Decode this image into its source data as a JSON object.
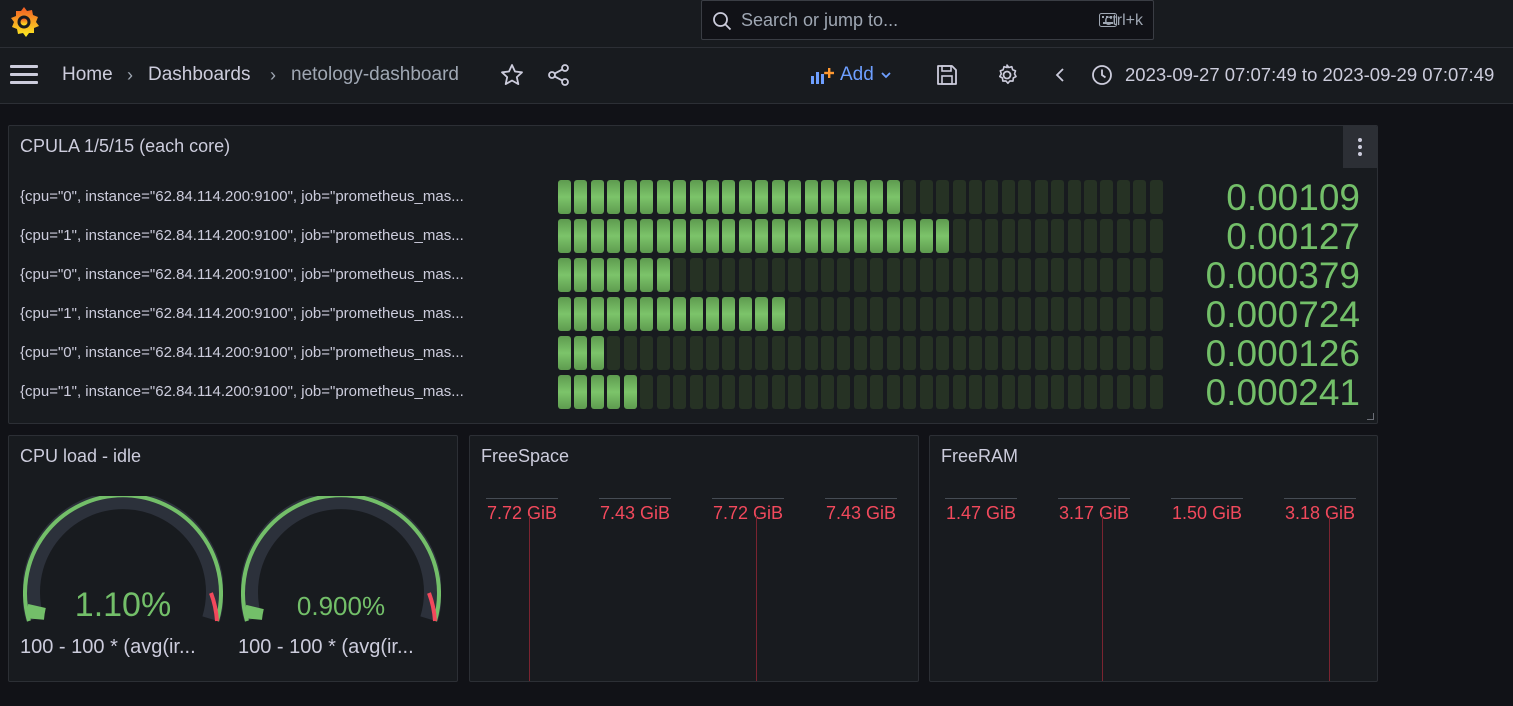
{
  "topbar": {
    "search_placeholder": "Search or jump to...",
    "search_shortcut": "ctrl+k"
  },
  "breadcrumb": {
    "home": "Home",
    "dashboards": "Dashboards",
    "current": "netology-dashboard"
  },
  "toolbar": {
    "add_label": "Add",
    "time_range": "2023-09-27 07:07:49 to 2023-09-29 07:07:49"
  },
  "panels": {
    "cpula": {
      "title": "CPULA 1/5/15 (each core)",
      "rows": [
        {
          "label": "{cpu=\"0\", instance=\"62.84.114.200:9100\", job=\"prometheus_mas...",
          "value": "0.00109",
          "lit": 21,
          "level": 0.57
        },
        {
          "label": "{cpu=\"1\", instance=\"62.84.114.200:9100\", job=\"prometheus_mas...",
          "value": "0.00127",
          "lit": 24,
          "level": 0.65
        },
        {
          "label": "{cpu=\"0\", instance=\"62.84.114.200:9100\", job=\"prometheus_mas...",
          "value": "0.000379",
          "lit": 7,
          "level": 0.19
        },
        {
          "label": "{cpu=\"1\", instance=\"62.84.114.200:9100\", job=\"prometheus_mas...",
          "value": "0.000724",
          "lit": 14,
          "level": 0.38
        },
        {
          "label": "{cpu=\"0\", instance=\"62.84.114.200:9100\", job=\"prometheus_mas...",
          "value": "0.000126",
          "lit": 3,
          "level": 0.08
        },
        {
          "label": "{cpu=\"1\", instance=\"62.84.114.200:9100\", job=\"prometheus_mas...",
          "value": "0.000241",
          "lit": 5,
          "level": 0.13
        }
      ],
      "total_cells": 37
    },
    "cpu_idle": {
      "title": "CPU load - idle",
      "gauges": [
        {
          "value": "1.10%",
          "fraction": 0.011,
          "label": "100 - 100 * (avg(ir..."
        },
        {
          "value": "0.900%",
          "fraction": 0.009,
          "label": "100 - 100 * (avg(ir..."
        }
      ]
    },
    "freespace": {
      "title": "FreeSpace",
      "values": [
        "7.72 GiB",
        "7.43 GiB",
        "7.72 GiB",
        "7.43 GiB"
      ]
    },
    "freeram": {
      "title": "FreeRAM",
      "values": [
        "1.47 GiB",
        "3.17 GiB",
        "1.50 GiB",
        "3.18 GiB"
      ]
    }
  },
  "colors": {
    "bg": "#111217",
    "panel": "#181b1f",
    "green": "#73bf69",
    "red": "#f2495c",
    "blue": "#6e9fff"
  }
}
